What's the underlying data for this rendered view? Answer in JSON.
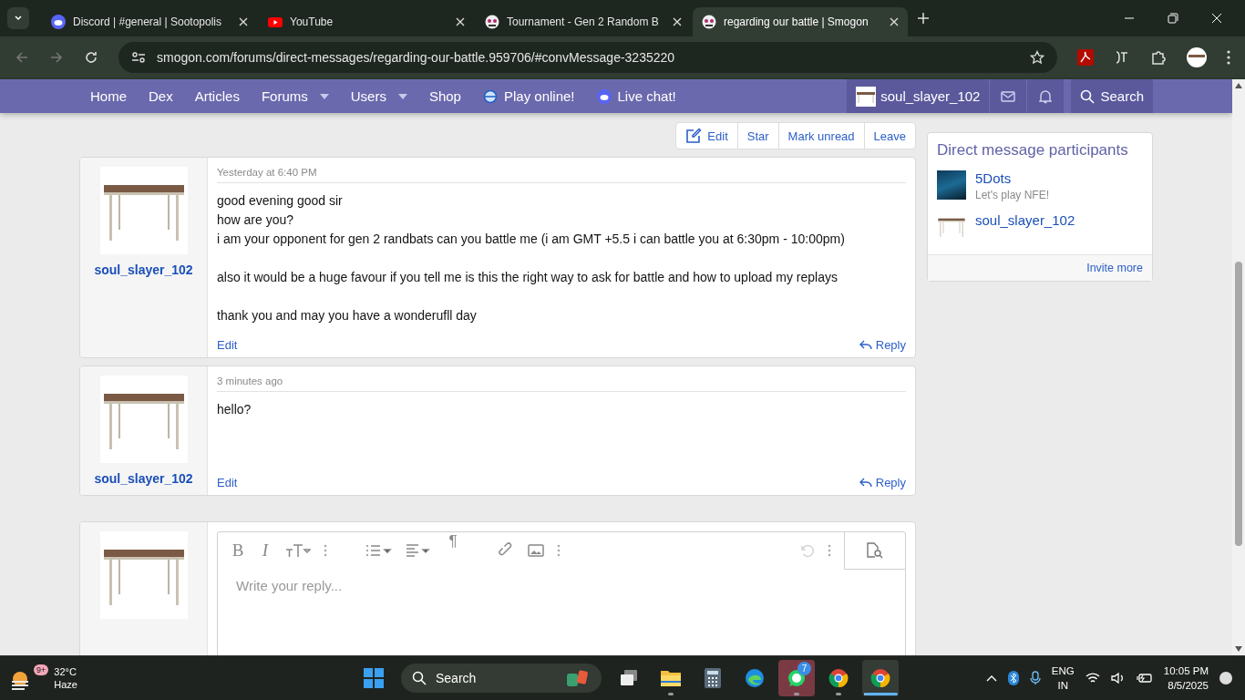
{
  "browser": {
    "tabs": [
      {
        "title": "Discord | #general | Sootopolis",
        "selected": false
      },
      {
        "title": "YouTube",
        "selected": false
      },
      {
        "title": "Tournament - Gen 2 Random B",
        "selected": false
      },
      {
        "title": "regarding our battle | Smogon",
        "selected": true
      }
    ],
    "url": "smogon.com/forums/direct-messages/regarding-our-battle.959706/#convMessage-3235220"
  },
  "site_nav": {
    "items": [
      {
        "label": "Home",
        "kind": "link"
      },
      {
        "label": "Dex",
        "kind": "link"
      },
      {
        "label": "Articles",
        "kind": "link"
      },
      {
        "label": "Forums",
        "kind": "dropdown"
      },
      {
        "label": "Users",
        "kind": "dropdown"
      },
      {
        "label": "Shop",
        "kind": "link"
      },
      {
        "label": "Play online!",
        "kind": "pokeball"
      },
      {
        "label": "Live chat!",
        "kind": "discord"
      }
    ],
    "user": "soul_slayer_102",
    "search": "Search"
  },
  "conversation_actions": [
    {
      "label": "Edit",
      "kind": "edit"
    },
    {
      "label": "Star",
      "kind": "plain"
    },
    {
      "label": "Mark unread",
      "kind": "plain"
    },
    {
      "label": "Leave",
      "kind": "plain"
    }
  ],
  "messages": [
    {
      "author": "soul_slayer_102",
      "time": "Yesterday at 6:40 PM",
      "paragraphs": [
        "good evening good sir\nhow are you?\ni am your opponent for gen 2 randbats can you battle me (i am GMT +5.5 i can battle you at 6:30pm - 10:00pm)",
        "also it would be a huge favour if you tell me is this the right way to ask for battle and how to upload my replays",
        "thank you and may you have a wonderufll day"
      ],
      "edit": "Edit",
      "reply": "Reply"
    },
    {
      "author": "soul_slayer_102",
      "time": "3 minutes ago",
      "paragraphs": [
        "hello?"
      ],
      "edit": "Edit",
      "reply": "Reply"
    }
  ],
  "editor": {
    "bold_button": "B",
    "italic_button": "I",
    "paragraph_button": "¶",
    "placeholder": "Write your reply...",
    "undo_disabled": true
  },
  "sidebar": {
    "title": "Direct message participants",
    "participants": [
      {
        "name": "5Dots",
        "note": "Let's play NFE!"
      },
      {
        "name": "soul_slayer_102"
      }
    ],
    "footer_link": "Invite more"
  },
  "taskbar": {
    "weather": {
      "badge": "9+",
      "temp": "32°C",
      "condition": "Haze"
    },
    "search": "Search",
    "apps": [
      {
        "kind": "task-view",
        "running": false,
        "active": false
      },
      {
        "kind": "folder",
        "running": true,
        "active": false
      },
      {
        "kind": "calculator",
        "running": false,
        "active": false
      },
      {
        "kind": "edge",
        "running": false,
        "active": false
      },
      {
        "kind": "whatsapp",
        "running": true,
        "active": false,
        "badge": "7",
        "attention": true
      },
      {
        "kind": "chrome",
        "running": true,
        "active": false
      },
      {
        "kind": "chrome",
        "running": true,
        "active": true
      }
    ],
    "language": "ENG",
    "region": "IN",
    "time": "10:05 PM",
    "date": "8/5/2025"
  }
}
